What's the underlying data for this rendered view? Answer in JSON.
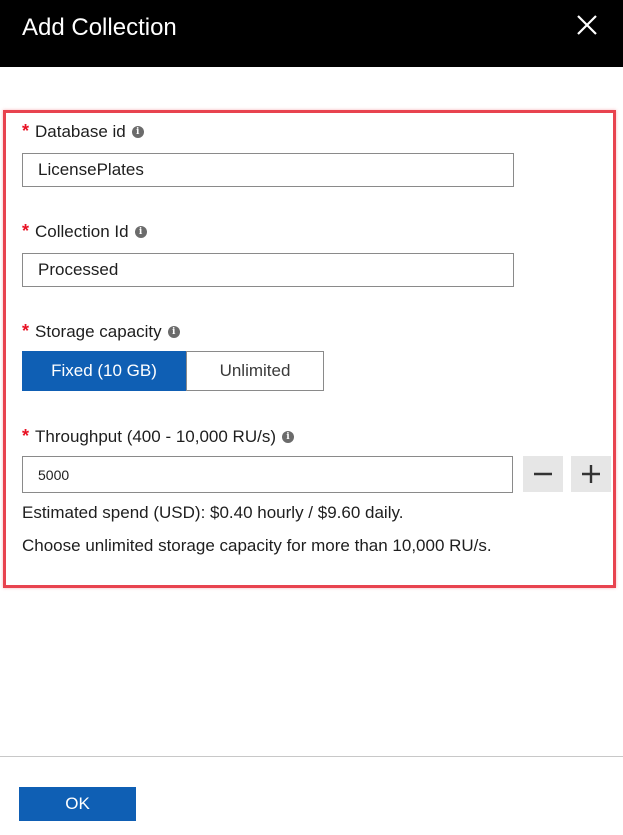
{
  "header": {
    "title": "Add Collection",
    "close_icon": "close-icon"
  },
  "form": {
    "database_id": {
      "required_marker": "*",
      "label": "Database id",
      "info_icon": "i",
      "value": "LicensePlates"
    },
    "collection_id": {
      "required_marker": "*",
      "label": "Collection Id",
      "info_icon": "i",
      "value": "Processed"
    },
    "storage_capacity": {
      "required_marker": "*",
      "label": "Storage capacity",
      "info_icon": "i",
      "options": [
        "Fixed (10 GB)",
        "Unlimited"
      ],
      "selected": "Fixed (10 GB)"
    },
    "throughput": {
      "required_marker": "*",
      "label": "Throughput (400 - 10,000 RU/s)",
      "info_icon": "i",
      "value": "5000",
      "decrement_icon": "minus-icon",
      "increment_icon": "plus-icon"
    },
    "estimated_spend": "Estimated spend (USD): $0.40 hourly / $9.60 daily.",
    "capacity_hint": "Choose unlimited storage capacity for more than 10,000 RU/s."
  },
  "footer": {
    "ok_label": "OK"
  },
  "colors": {
    "header_bg": "#000000",
    "accent": "#0f5fb4",
    "required": "#e81123",
    "highlight_border": "#e8434f"
  }
}
